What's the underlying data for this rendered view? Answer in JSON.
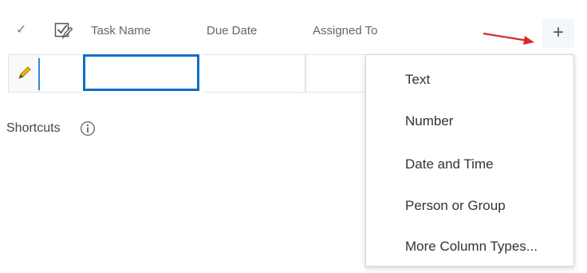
{
  "header": {
    "check_glyph": "✓",
    "edit_icon": "checkbox-edit-icon",
    "columns": [
      "Task Name",
      "Due Date",
      "Assigned To"
    ],
    "add_column_glyph": "+"
  },
  "edit_row": {
    "pencil_icon": "pencil-icon",
    "task_name_value": "",
    "due_date_value": "",
    "assigned_to_value": ""
  },
  "shortcuts": {
    "label": "Shortcuts",
    "info_icon": "info-icon"
  },
  "add_column_menu": {
    "items": [
      "Text",
      "Number",
      "Date and Time",
      "Person or Group",
      "More Column Types..."
    ]
  },
  "colors": {
    "accent_blue": "#0f6fc6",
    "arrow_red": "#d42a2a",
    "plus_bg": "#f2f7fa"
  }
}
